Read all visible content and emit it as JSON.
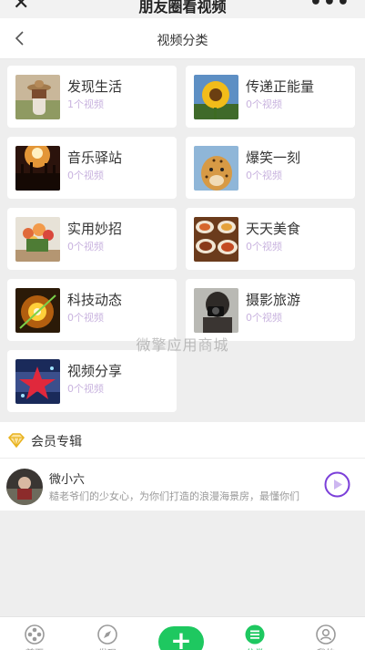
{
  "app": {
    "title": "朋友圈看视频",
    "close_icon": "close-icon",
    "more_icon": "more-dots-icon"
  },
  "nav": {
    "title": "视频分类",
    "back_icon": "chevron-left-icon"
  },
  "categories": [
    {
      "name": "发现生活",
      "count": "1个视频",
      "thumb": "girl-with-hat-photo"
    },
    {
      "name": "传递正能量",
      "count": "0个视频",
      "thumb": "sunflower-photo"
    },
    {
      "name": "音乐驿站",
      "count": "0个视频",
      "thumb": "concert-crowd-photo"
    },
    {
      "name": "爆笑一刻",
      "count": "0个视频",
      "thumb": "cheetah-photo"
    },
    {
      "name": "实用妙招",
      "count": "0个视频",
      "thumb": "flowers-photo"
    },
    {
      "name": "天天美食",
      "count": "0个视频",
      "thumb": "food-dishes-photo"
    },
    {
      "name": "科技动态",
      "count": "0个视频",
      "thumb": "glowing-tech-photo"
    },
    {
      "name": "摄影旅游",
      "count": "0个视频",
      "thumb": "photographer-photo"
    },
    {
      "name": "视频分享",
      "count": "0个视频",
      "thumb": "film-star-photo"
    }
  ],
  "watermark": "微擎应用商城",
  "member": {
    "section_title": "会员专辑",
    "section_icon": "diamond-icon",
    "items": [
      {
        "name": "微小六",
        "desc": "糙老爷们的少女心，为你们打造的浪漫海景房，最懂你们",
        "action_icon": "play-circle-icon"
      }
    ]
  },
  "tabbar": {
    "tabs": [
      {
        "label": "首页",
        "icon": "film-reel-icon"
      },
      {
        "label": "发现",
        "icon": "compass-icon"
      },
      {
        "label": "",
        "icon": "plus-icon"
      },
      {
        "label": "分类",
        "icon": "list-icon"
      },
      {
        "label": "我的",
        "icon": "user-icon"
      }
    ]
  },
  "colors": {
    "accent": "#1ec860",
    "count_text": "#c9b4df",
    "background": "#eeeeee"
  }
}
